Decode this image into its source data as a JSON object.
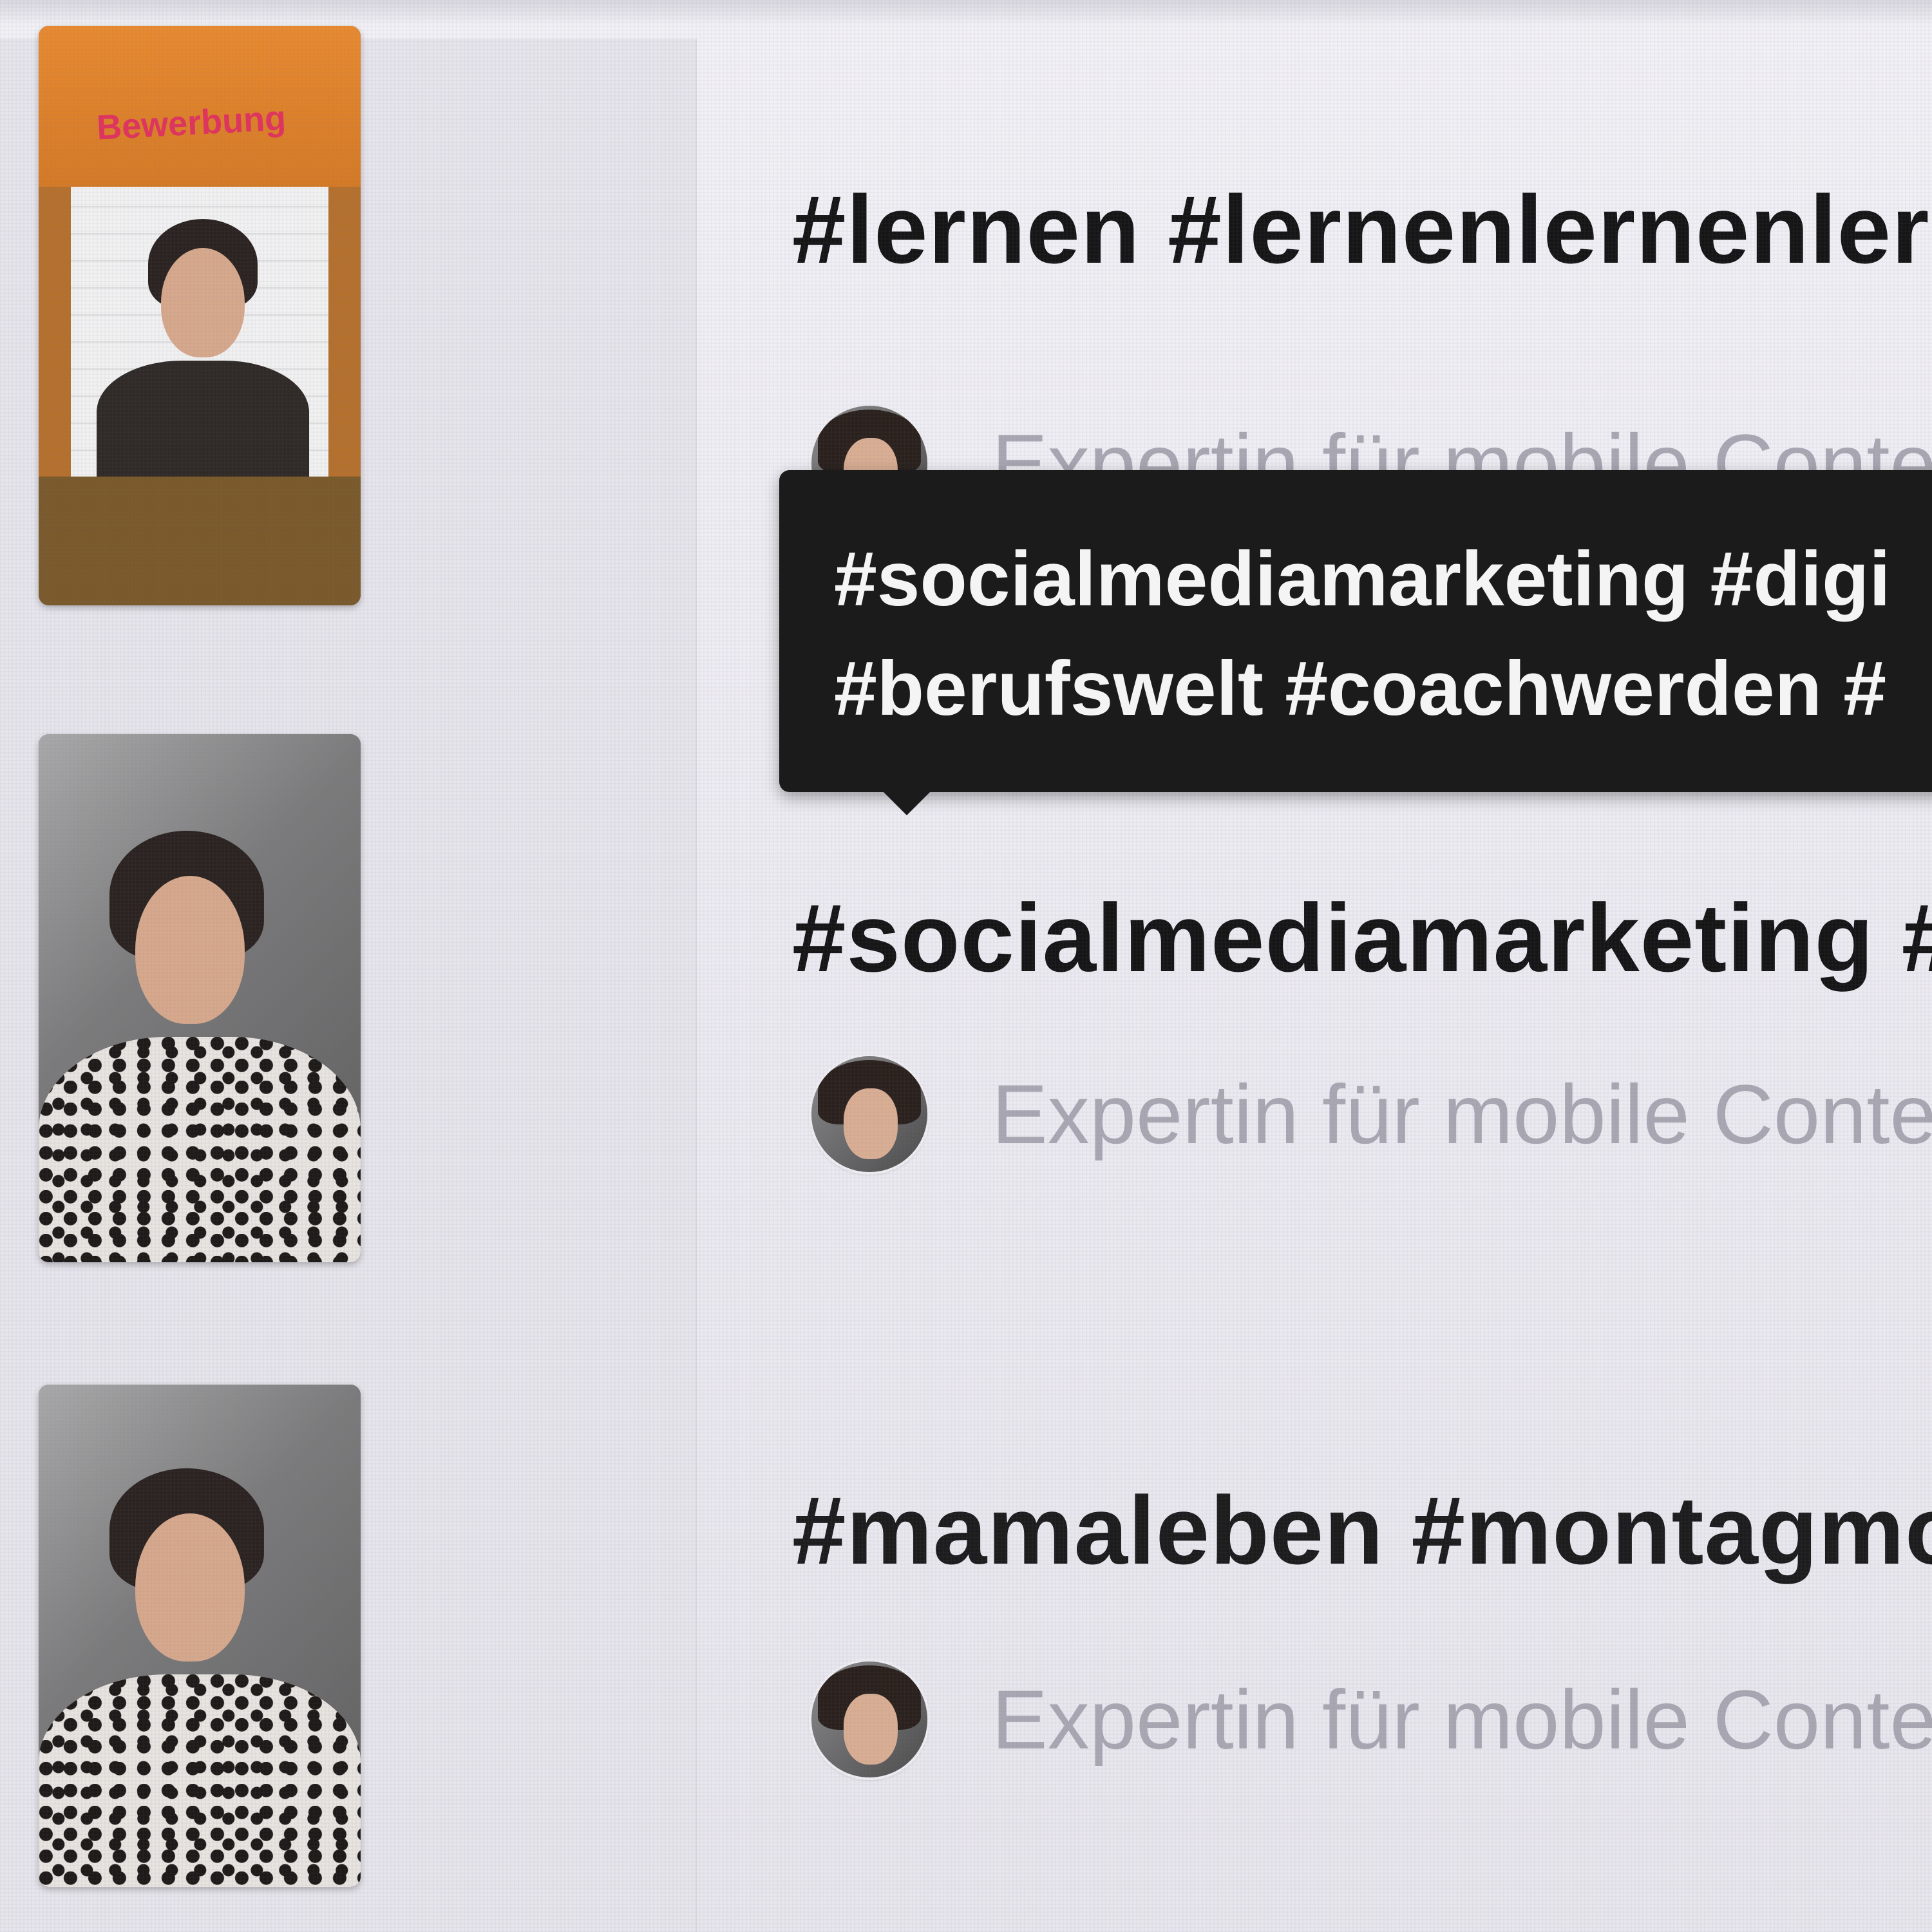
{
  "posts": [
    {
      "thumbnail": {
        "banner_text": "Bewerbung",
        "kind": "orange-banner-portrait"
      },
      "hashtags": "#lernen #lernenlernenler",
      "author": {
        "description": "Expertin für mobile Content"
      }
    },
    {
      "thumbnail": {
        "kind": "portrait-patterned-top"
      },
      "hashtags": "#socialmediamarketing #d",
      "author": {
        "description": "Expertin für mobile Conte"
      }
    },
    {
      "thumbnail": {
        "kind": "portrait-patterned-top"
      },
      "hashtags": "#mamaleben #montagmoti",
      "author": {
        "description": "Expertin für mobile Content"
      }
    }
  ],
  "tooltip": {
    "line1": "#socialmediamarketing #digi",
    "line2": "#berufswelt #coachwerden #"
  },
  "colors": {
    "background": "#ecebf1",
    "text": "#151515",
    "muted_text": "#a9a8b2",
    "tooltip_bg": "#1b1b1b",
    "tooltip_text": "#f4f4f4",
    "thumb_banner": "#e88a2f",
    "thumb_banner_text": "#e0335d"
  }
}
